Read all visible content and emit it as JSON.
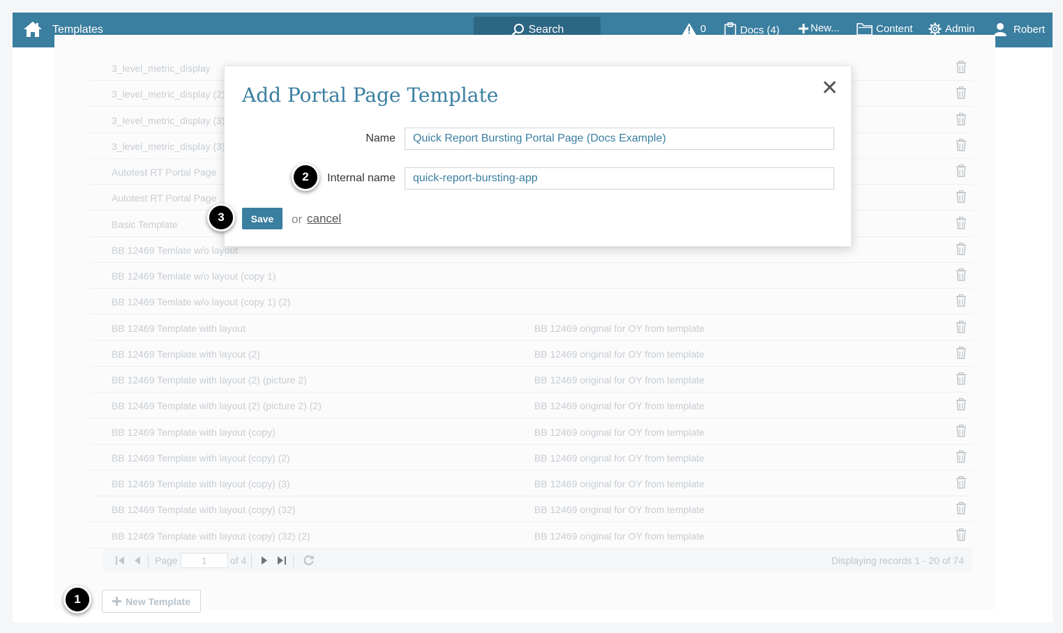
{
  "header": {
    "title": "Templates",
    "search_label": "Search",
    "alerts_count": "0",
    "docs_label": "Docs (4)",
    "new_label": "New...",
    "content_label": "Content",
    "admin_label": "Admin",
    "user_label": "Robert"
  },
  "rows": [
    {
      "name": "3_level_metric_display",
      "desc": ""
    },
    {
      "name": "3_level_metric_display (2)",
      "desc": ""
    },
    {
      "name": "3_level_metric_display (3)",
      "desc": ""
    },
    {
      "name": "3_level_metric_display (3)",
      "desc": ""
    },
    {
      "name": "Autotest RT Portal Page",
      "desc": ""
    },
    {
      "name": "Autotest RT Portal Page",
      "desc": ""
    },
    {
      "name": "Basic Template",
      "desc": ""
    },
    {
      "name": "BB 12469 Temlate w/o layout",
      "desc": ""
    },
    {
      "name": "BB 12469 Temlate w/o layout (copy 1)",
      "desc": ""
    },
    {
      "name": "BB 12469 Temlate w/o layout (copy 1) (2)",
      "desc": ""
    },
    {
      "name": "BB 12469 Template with layout",
      "desc": "BB 12469 original for OY from template"
    },
    {
      "name": "BB 12469 Template with layout (2)",
      "desc": "BB 12469 original for OY from template"
    },
    {
      "name": "BB 12469 Template with layout (2) (picture 2)",
      "desc": "BB 12469 original for OY from template"
    },
    {
      "name": "BB 12469 Template with layout (2) (picture 2) (2)",
      "desc": "BB 12469 original for OY from template"
    },
    {
      "name": "BB 12469 Template with layout (copy)",
      "desc": "BB 12469 original for OY from template"
    },
    {
      "name": "BB 12469 Template with layout (copy) (2)",
      "desc": "BB 12469 original for OY from template"
    },
    {
      "name": "BB 12469 Template with layout (copy) (3)",
      "desc": "BB 12469 original for OY from template"
    },
    {
      "name": "BB 12469 Template with layout (copy) (32)",
      "desc": "BB 12469 original for OY from template"
    },
    {
      "name": "BB 12469 Template with layout (copy) (32) (2)",
      "desc": "BB 12469 original for OY from template"
    }
  ],
  "pager": {
    "page_label": "Page",
    "page_value": "1",
    "of_label": "of 4",
    "records_label": "Displaying records 1 - 20 of 74"
  },
  "new_template_label": "New Template",
  "modal": {
    "title": "Add Portal Page Template",
    "name_label": "Name",
    "name_value": "Quick Report Bursting Portal Page (Docs Example)",
    "internal_label": "Internal name",
    "internal_value": "quick-report-bursting-app",
    "save_label": "Save",
    "or_label": "or",
    "cancel_label": "cancel"
  },
  "callouts": [
    "1",
    "2",
    "3"
  ],
  "colors": {
    "brand": "#3a7ea0",
    "search_bg": "#2d6683",
    "faded_text": "#c7cdd3"
  }
}
